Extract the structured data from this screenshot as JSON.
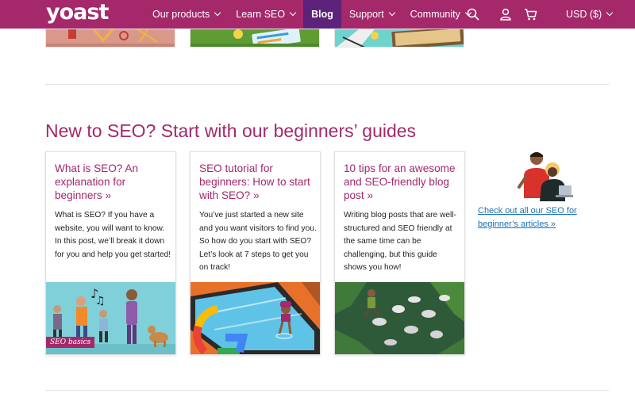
{
  "header": {
    "logo": "yoast",
    "nav": [
      {
        "label": "Our products",
        "dropdown": true,
        "active": false
      },
      {
        "label": "Learn SEO",
        "dropdown": true,
        "active": false
      },
      {
        "label": "Blog",
        "dropdown": false,
        "active": true
      },
      {
        "label": "Support",
        "dropdown": true,
        "active": false
      },
      {
        "label": "Community",
        "dropdown": true,
        "active": false
      }
    ],
    "icons": [
      "search-icon",
      "user-icon",
      "cart-icon"
    ],
    "currency": "USD ($)"
  },
  "section": {
    "title": "New to SEO? Start with our beginners’ guides",
    "cards": [
      {
        "title": "What is SEO? An explanation for beginners »",
        "text": "What is SEO? If you have a website, you will want to know. In this post, we’ll break it down for you and help you get started!",
        "tag": "SEO basics"
      },
      {
        "title": "SEO tutorial for beginners: How to start with SEO? »",
        "text": "You’ve just started a new site and you want visitors to find you. So how do you start with SEO? Let’s look at 7 steps to get you on track!",
        "tag": ""
      },
      {
        "title": "10 tips for an awesome and SEO-friendly blog post »",
        "text": "Writing blog posts that are well-structured and SEO friendly at the same time can be challenging, but this guide shows you how!",
        "tag": ""
      }
    ],
    "side_link": "Check out all our SEO for beginner’s articles »"
  },
  "colors": {
    "brand": "#a4286a",
    "nav_active": "#5d237a",
    "link": "#1a6fb3"
  }
}
